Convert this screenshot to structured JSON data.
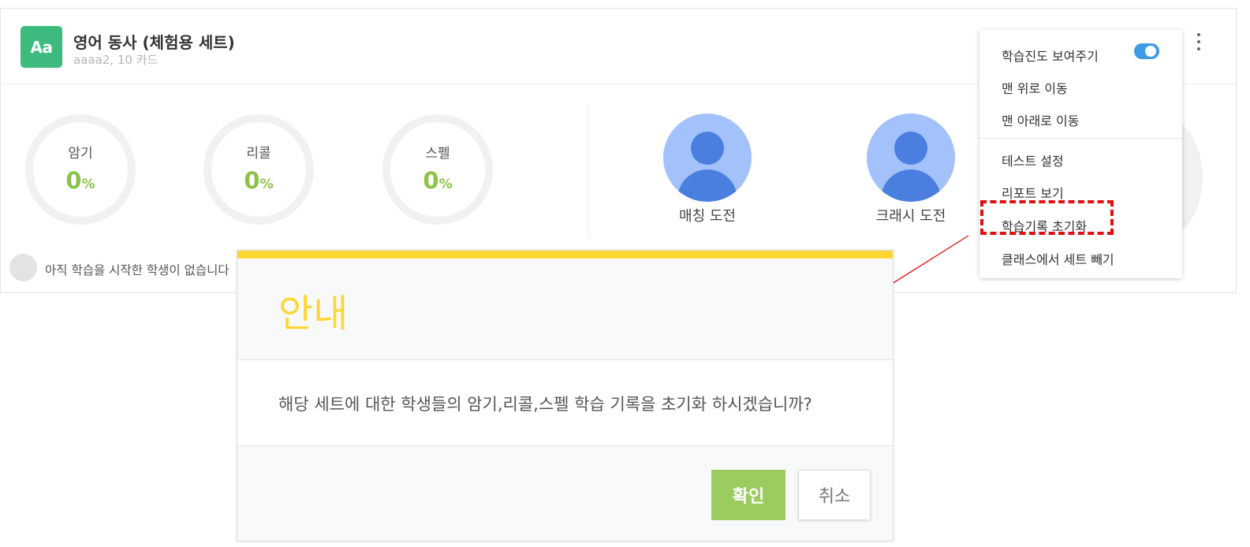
{
  "set": {
    "logo_text": "Aa",
    "title": "영어 동사 (체험용 세트)",
    "meta": "aaaa2, 10 카드"
  },
  "stats": [
    {
      "label": "암기",
      "value": "0",
      "unit": "%"
    },
    {
      "label": "리콜",
      "value": "0",
      "unit": "%"
    },
    {
      "label": "스펠",
      "value": "0",
      "unit": "%"
    }
  ],
  "games": [
    {
      "label": "매칭 도전"
    },
    {
      "label": "크래시 도전"
    }
  ],
  "students": {
    "empty_text": "아직 학습을 시작한 학생이 없습니다"
  },
  "menu": {
    "items": [
      {
        "label": "학습진도 보여주기",
        "toggle_on": true
      },
      {
        "label": "맨 위로 이동"
      },
      {
        "label": "맨 아래로 이동"
      },
      {
        "label": "테스트 설정"
      },
      {
        "label": "리포트 보기"
      },
      {
        "label": "학습기록 초기화",
        "highlighted": true
      },
      {
        "label": "클래스에서 세트 빼기"
      }
    ]
  },
  "modal": {
    "title": "안내",
    "message": "해당 세트에 대한 학생들의 암기,리콜,스펠 학습 기록을 초기화 하시겠습니까?",
    "confirm_label": "확인",
    "cancel_label": "취소"
  },
  "colors": {
    "logo_bg": "#3dbb7e",
    "progress_green": "#8bc34a",
    "avatar_bg": "#a3c1fb",
    "avatar_fg": "#4a7fe0",
    "toggle_on": "#3d9be6",
    "modal_accent": "#fdd835",
    "confirm_bg": "#9ccc5f",
    "highlight_red": "#e01010"
  }
}
